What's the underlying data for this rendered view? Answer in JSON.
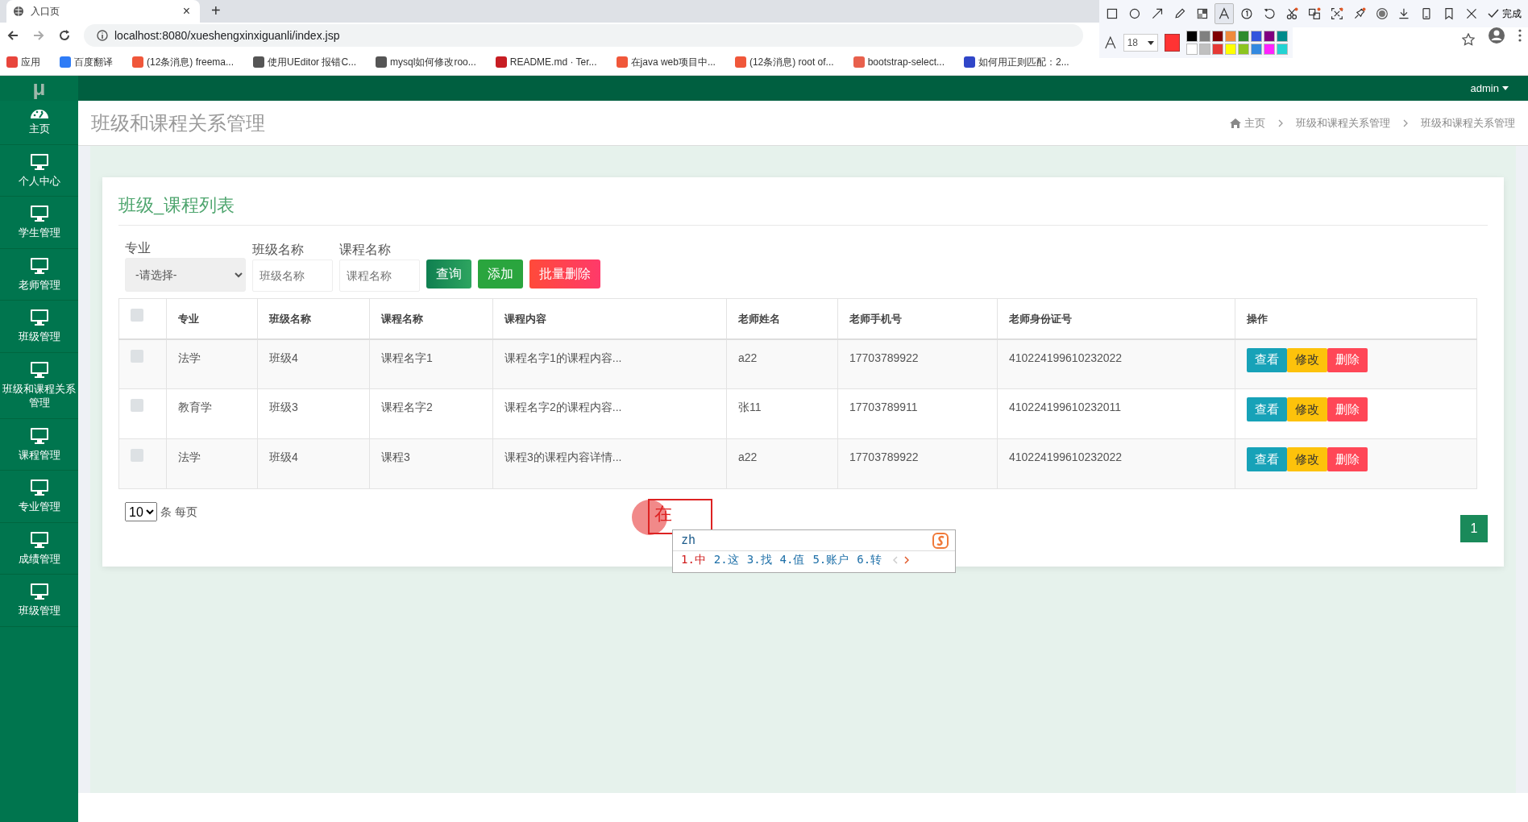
{
  "browser": {
    "tab_title": "入口页",
    "tab_close": "×",
    "new_tab": "+",
    "url": "localhost:8080/xueshengxinxiguanli/index.jsp",
    "bookmarks": [
      {
        "label": "应用",
        "color": "#e8453c"
      },
      {
        "label": "百度翻译",
        "color": "#2f7cf6"
      },
      {
        "label": "(12条消息) freema...",
        "color": "#f0573a"
      },
      {
        "label": "使用UEditor 报错C...",
        "color": "#555555"
      },
      {
        "label": "mysql如何修改roo...",
        "color": "#555555"
      },
      {
        "label": "README.md · Ter...",
        "color": "#c71d23"
      },
      {
        "label": "在java web项目中...",
        "color": "#f0573a"
      },
      {
        "label": "(12条消息) root of...",
        "color": "#f0573a"
      },
      {
        "label": "bootstrap-select...",
        "color": "#e8604c"
      },
      {
        "label": "如何用正则匹配：2...",
        "color": "#3046c8"
      }
    ]
  },
  "capture_toolbar": {
    "tools": [
      {
        "kind": "rect",
        "selected": false
      },
      {
        "kind": "circle",
        "selected": false
      },
      {
        "kind": "arrow",
        "selected": false
      },
      {
        "kind": "pencil",
        "selected": false
      },
      {
        "kind": "mosaic",
        "selected": false
      },
      {
        "kind": "text",
        "selected": true
      },
      {
        "kind": "number",
        "selected": false
      },
      {
        "kind": "undo",
        "selected": false
      },
      {
        "kind": "cut",
        "selected": false
      },
      {
        "kind": "translate",
        "selected": false
      },
      {
        "kind": "ocr",
        "selected": false
      },
      {
        "kind": "pin",
        "selected": false
      },
      {
        "kind": "record",
        "selected": false
      },
      {
        "kind": "download",
        "selected": false
      },
      {
        "kind": "phone",
        "selected": false
      },
      {
        "kind": "bookmark",
        "selected": false
      },
      {
        "kind": "close",
        "selected": false
      }
    ],
    "done": "完成",
    "font_size": "18",
    "current_color": {
      "color": "#ff3333"
    },
    "swatches": [
      {
        "color": "#000000"
      },
      {
        "color": "#808080"
      },
      {
        "color": "#800000"
      },
      {
        "color": "#f08a3c"
      },
      {
        "color": "#2e8b2e"
      },
      {
        "color": "#3355dd"
      },
      {
        "color": "#800080"
      },
      {
        "color": "#008b8b"
      },
      {
        "color": "#ffffff"
      },
      {
        "color": "#c0c0c0"
      },
      {
        "color": "#e53935"
      },
      {
        "color": "#ffff00"
      },
      {
        "color": "#8cc520"
      },
      {
        "color": "#3389e0"
      },
      {
        "color": "#ff22ff"
      },
      {
        "color": "#22d3d3"
      }
    ]
  },
  "navbar": {
    "logo": "μ",
    "user": "admin"
  },
  "sidebar": {
    "items": [
      {
        "label": "主页",
        "kind": "dashboard"
      },
      {
        "label": "个人中心",
        "kind": "monitor"
      },
      {
        "label": "学生管理",
        "kind": "monitor"
      },
      {
        "label": "老师管理",
        "kind": "monitor"
      },
      {
        "label": "班级管理",
        "kind": "monitor"
      },
      {
        "label": "班级和课程关系管理",
        "kind": "monitor"
      },
      {
        "label": "课程管理",
        "kind": "monitor"
      },
      {
        "label": "专业管理",
        "kind": "monitor"
      },
      {
        "label": "成绩管理",
        "kind": "monitor"
      },
      {
        "label": "班级管理",
        "kind": "monitor"
      }
    ]
  },
  "page_header": {
    "title": "班级和课程关系管理",
    "breadcrumb": [
      "主页",
      "班级和课程关系管理",
      "班级和课程关系管理"
    ]
  },
  "card": {
    "title": "班级_课程列表",
    "filters": [
      {
        "label": "专业",
        "kind": "select",
        "value": "-请选择-"
      },
      {
        "label": "班级名称",
        "kind": "input",
        "placeholder": "班级名称"
      },
      {
        "label": "课程名称",
        "kind": "input",
        "placeholder": "课程名称"
      }
    ],
    "buttons": [
      {
        "label": "查询",
        "kind": "query"
      },
      {
        "label": "添加",
        "kind": "add"
      },
      {
        "label": "批量删除",
        "kind": "delete"
      }
    ],
    "table": {
      "header_checked": false,
      "columns": [
        "专业",
        "班级名称",
        "课程名称",
        "课程内容",
        "老师姓名",
        "老师手机号",
        "老师身份证号",
        "操作"
      ],
      "rows": [
        {
          "checked": false,
          "cells": [
            "法学",
            "班级4",
            "课程名字1",
            "课程名字1的课程内容...",
            "a22",
            "17703789922",
            "410224199610232022"
          ],
          "actions": [
            {
              "label": "查看",
              "kind": "view"
            },
            {
              "label": "修改",
              "kind": "edit"
            },
            {
              "label": "删除",
              "kind": "delete"
            }
          ]
        },
        {
          "checked": false,
          "cells": [
            "教育学",
            "班级3",
            "课程名字2",
            "课程名字2的课程内容...",
            "张11",
            "17703789911",
            "410224199610232011"
          ],
          "actions": [
            {
              "label": "查看",
              "kind": "view"
            },
            {
              "label": "修改",
              "kind": "edit"
            },
            {
              "label": "删除",
              "kind": "delete"
            }
          ]
        },
        {
          "checked": false,
          "cells": [
            "法学",
            "班级4",
            "课程3",
            "课程3的课程内容详情...",
            "a22",
            "17703789922",
            "410224199610232022"
          ],
          "actions": [
            {
              "label": "查看",
              "kind": "view"
            },
            {
              "label": "修改",
              "kind": "edit"
            },
            {
              "label": "删除",
              "kind": "delete"
            }
          ]
        }
      ]
    },
    "page_size": "10",
    "page_size_suffix": "条 每页",
    "pages": [
      {
        "label": "1",
        "selected": true
      }
    ]
  },
  "annotation": {
    "text": "在"
  },
  "ime": {
    "input": "zh",
    "candidates": [
      {
        "label": "1.中",
        "selected": true
      },
      {
        "label": "2.这",
        "selected": false
      },
      {
        "label": "3.找",
        "selected": false
      },
      {
        "label": "4.值",
        "selected": false
      },
      {
        "label": "5.账户",
        "selected": false
      },
      {
        "label": "6.转",
        "selected": false
      }
    ]
  }
}
